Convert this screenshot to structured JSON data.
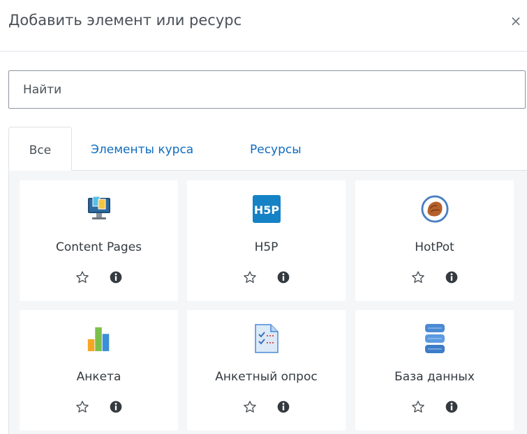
{
  "modal": {
    "title": "Добавить элемент или ресурс",
    "close_symbol": "×"
  },
  "search": {
    "placeholder": "Найти"
  },
  "tabs": [
    {
      "label": "Все",
      "active": true
    },
    {
      "label": "Элементы курса",
      "active": false
    },
    {
      "label": "Ресурсы",
      "active": false
    }
  ],
  "modules": [
    {
      "label": "Content Pages",
      "icon": "monitor-icon"
    },
    {
      "label": "H5P",
      "icon": "h5p-icon"
    },
    {
      "label": "HotPot",
      "icon": "hotpot-icon"
    },
    {
      "label": "Анкета",
      "icon": "bar-chart-icon"
    },
    {
      "label": "Анкетный опрос",
      "icon": "checklist-icon"
    },
    {
      "label": "База данных",
      "icon": "database-icon"
    }
  ],
  "icons": {
    "star": "star-outline-icon",
    "info": "info-circle-icon"
  },
  "colors": {
    "link": "#0f6cbf",
    "text": "#343a40",
    "border": "#dee2e6",
    "content_bg": "#f5f6f8"
  }
}
